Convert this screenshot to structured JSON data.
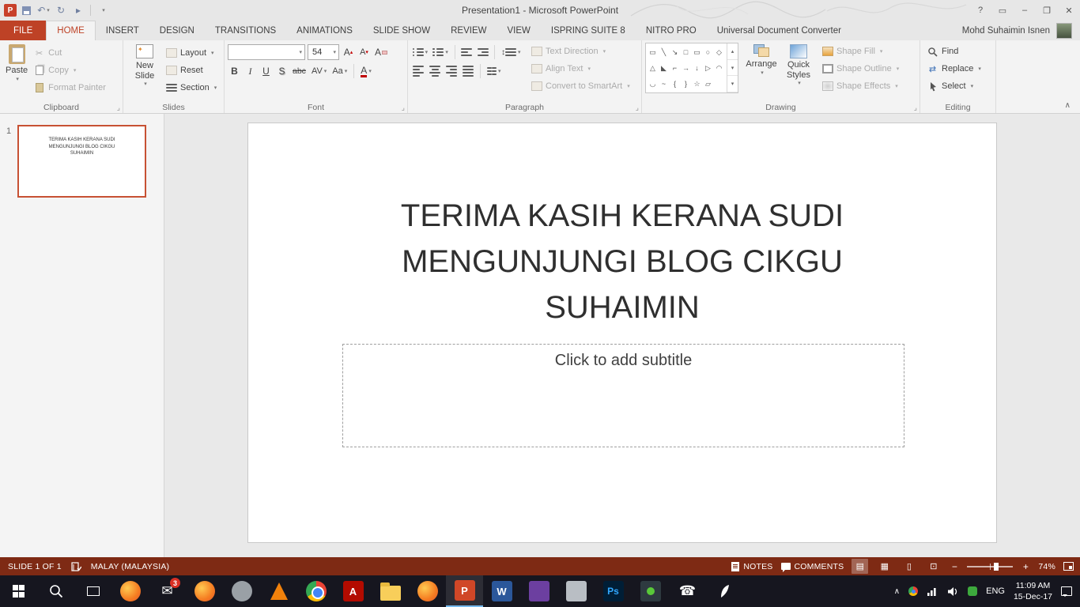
{
  "window": {
    "title": "Presentation1 - Microsoft PowerPoint"
  },
  "letters": {
    "p": "P",
    "w": "W",
    "ps": "Ps",
    "a": "A"
  },
  "icons": {
    "dropdown": "▾",
    "dialog_launcher": "⌟",
    "cut": "✂",
    "undo": "↶",
    "redo": "↻",
    "play": "▸",
    "help": "?",
    "ribbon_options": "▭",
    "minimize": "–",
    "restore": "❐",
    "close": "✕",
    "tri_up": "▴",
    "tri_down": "▾",
    "updown": "↕",
    "star": "✦",
    "collapse_ribbon": "∧",
    "tray_chevron": "∧",
    "view_normal": "▤",
    "view_sorter": "▦",
    "view_reading": "▯",
    "view_show": "⊡",
    "zoom_out": "−",
    "zoom_in": "+",
    "replace": "⇄",
    "envelope": "✉",
    "phone": "☎",
    "shapes_row1": [
      "▭",
      "╲",
      "↘",
      "□",
      "▭",
      "○",
      "◇"
    ],
    "shapes_row2": [
      "△",
      "◣",
      "⌐",
      "→",
      "↓",
      "▷",
      "◠"
    ],
    "shapes_row3": [
      "◡",
      "~",
      "{",
      "}",
      "☆",
      "▱"
    ]
  },
  "tabs": [
    "FILE",
    "HOME",
    "INSERT",
    "DESIGN",
    "TRANSITIONS",
    "ANIMATIONS",
    "SLIDE SHOW",
    "REVIEW",
    "VIEW",
    "ISPRING SUITE 8",
    "NITRO PRO",
    "Universal Document Converter"
  ],
  "user_name": "Mohd Suhaimin Isnen",
  "clipboard": {
    "paste": "Paste",
    "cut": "Cut",
    "copy": "Copy",
    "format_painter": "Format Painter",
    "label": "Clipboard"
  },
  "slides_group": {
    "new_slide": "New Slide",
    "layout": "Layout",
    "reset": "Reset",
    "section": "Section",
    "label": "Slides"
  },
  "font_group": {
    "font_name": "",
    "size": "54",
    "grow": "A",
    "shrink": "A",
    "clear": "A",
    "bold": "B",
    "italic": "I",
    "underline": "U",
    "shadow": "S",
    "strike": "abc",
    "spacing": "AV",
    "case_btn": "Aa",
    "color": "A",
    "label": "Font"
  },
  "paragraph_group": {
    "text_direction": "Text Direction",
    "align_text": "Align Text",
    "smartart": "Convert to SmartArt",
    "label": "Paragraph"
  },
  "drawing_group": {
    "arrange": "Arrange",
    "quick_styles": "Quick Styles",
    "shape_fill": "Shape Fill",
    "shape_outline": "Shape Outline",
    "shape_effects": "Shape Effects",
    "label": "Drawing"
  },
  "editing_group": {
    "find": "Find",
    "replace": "Replace",
    "select": "Select",
    "label": "Editing"
  },
  "slides_panel": {
    "number": "1",
    "thumb_title": "TERIMA KASIH KERANA SUDI MENGUNJUNGI BLOG CIKGU SUHAIMIN"
  },
  "slide": {
    "title": "TERIMA KASIH KERANA SUDI MENGUNJUNGI BLOG CIKGU SUHAIMIN",
    "subtitle": "Click to add subtitle"
  },
  "status": {
    "slide": "SLIDE 1 OF 1",
    "language": "MALAY (MALAYSIA)",
    "notes": "NOTES",
    "comments": "COMMENTS",
    "zoom": "74%"
  },
  "taskbar": {
    "mail_badge": "3",
    "lang": "ENG",
    "time": "11:09 AM",
    "date": "15-Dec-17"
  }
}
